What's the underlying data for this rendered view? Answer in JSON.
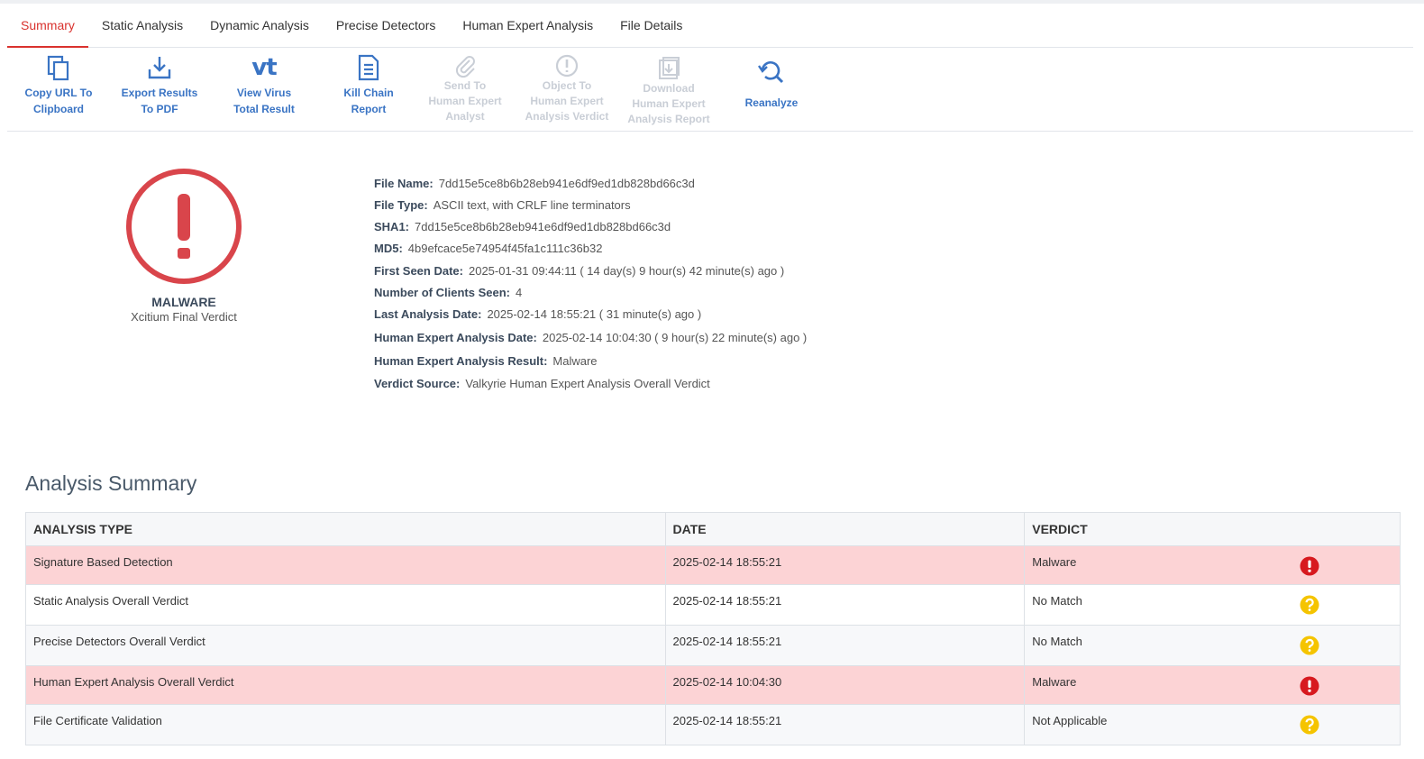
{
  "tabs": [
    {
      "label": "Summary",
      "active": true
    },
    {
      "label": "Static Analysis",
      "active": false
    },
    {
      "label": "Dynamic Analysis",
      "active": false
    },
    {
      "label": "Precise Detectors",
      "active": false
    },
    {
      "label": "Human Expert Analysis",
      "active": false
    },
    {
      "label": "File Details",
      "active": false
    }
  ],
  "toolbar": {
    "copy_url": {
      "line1": "Copy URL To",
      "line2": "Clipboard",
      "icon": "copy-icon"
    },
    "export_pdf": {
      "line1": "Export Results",
      "line2": "To PDF",
      "icon": "download-tray-icon"
    },
    "virustotal": {
      "line1": "View Virus",
      "line2": "Total Result",
      "glyph": "vt",
      "icon": "virustotal-icon"
    },
    "kill_chain": {
      "line1": "Kill Chain",
      "line2": "Report",
      "icon": "document-icon"
    },
    "send_expert": {
      "line1": "Send To",
      "line2": "Human Expert",
      "line3": "Analyst",
      "icon": "paperclip-icon",
      "disabled": true
    },
    "object_verdict": {
      "line1": "Object To",
      "line2": "Human Expert",
      "line3": "Analysis Verdict",
      "icon": "alert-circle-icon",
      "disabled": true
    },
    "download_report": {
      "line1": "Download",
      "line2": "Human Expert",
      "line3": "Analysis Report",
      "icon": "download-box-icon",
      "disabled": true
    },
    "reanalyze": {
      "label": "Reanalyze",
      "icon": "refresh-search-icon"
    }
  },
  "verdict": {
    "label": "MALWARE",
    "sublabel": "Xcitium Final Verdict",
    "color": "#d9454b",
    "icon": "exclamation-circle-icon"
  },
  "details": [
    {
      "key": "File Name:",
      "value": "7dd15e5ce8b6b28eb941e6df9ed1db828bd66c3d"
    },
    {
      "key": "File Type:",
      "value": "ASCII text, with CRLF line terminators"
    },
    {
      "key": "SHA1:",
      "value": "7dd15e5ce8b6b28eb941e6df9ed1db828bd66c3d"
    },
    {
      "key": "MD5:",
      "value": "4b9efcace5e74954f45fa1c111c36b32"
    },
    {
      "key": "First Seen Date:",
      "value": "2025-01-31 09:44:11 ( 14 day(s) 9 hour(s) 42 minute(s) ago )"
    },
    {
      "key": "Number of Clients Seen:",
      "value": "4"
    },
    {
      "key": "Last Analysis Date:",
      "value": "2025-02-14 18:55:21 ( 31 minute(s) ago )"
    },
    {
      "key": "Human Expert Analysis Date:",
      "value": "2025-02-14 10:04:30 ( 9 hour(s) 22 minute(s) ago )"
    },
    {
      "key": "Human Expert Analysis Result:",
      "value": "Malware"
    },
    {
      "key": "Verdict Source:",
      "value": "Valkyrie Human Expert Analysis Overall Verdict"
    }
  ],
  "summary": {
    "title": "Analysis Summary",
    "headers": {
      "type": "ANALYSIS TYPE",
      "date": "DATE",
      "verdict": "VERDICT"
    },
    "rows": [
      {
        "type": "Signature Based Detection",
        "date": "2025-02-14 18:55:21",
        "verdict": "Malware",
        "status": "malware"
      },
      {
        "type": "Static Analysis Overall Verdict",
        "date": "2025-02-14 18:55:21",
        "verdict": "No Match",
        "status": "unknown"
      },
      {
        "type": "Precise Detectors Overall Verdict",
        "date": "2025-02-14 18:55:21",
        "verdict": "No Match",
        "status": "unknown"
      },
      {
        "type": "Human Expert Analysis Overall Verdict",
        "date": "2025-02-14 10:04:30",
        "verdict": "Malware",
        "status": "malware"
      },
      {
        "type": "File Certificate Validation",
        "date": "2025-02-14 18:55:21",
        "verdict": "Not Applicable",
        "status": "unknown"
      }
    ]
  },
  "colors": {
    "accent_red": "#d9322e",
    "link_blue": "#3a74c4",
    "disabled": "#c9ced6",
    "malware_row": "#fcd3d5",
    "unknown_icon": "#f5c400",
    "malware_icon": "#d7191f"
  }
}
